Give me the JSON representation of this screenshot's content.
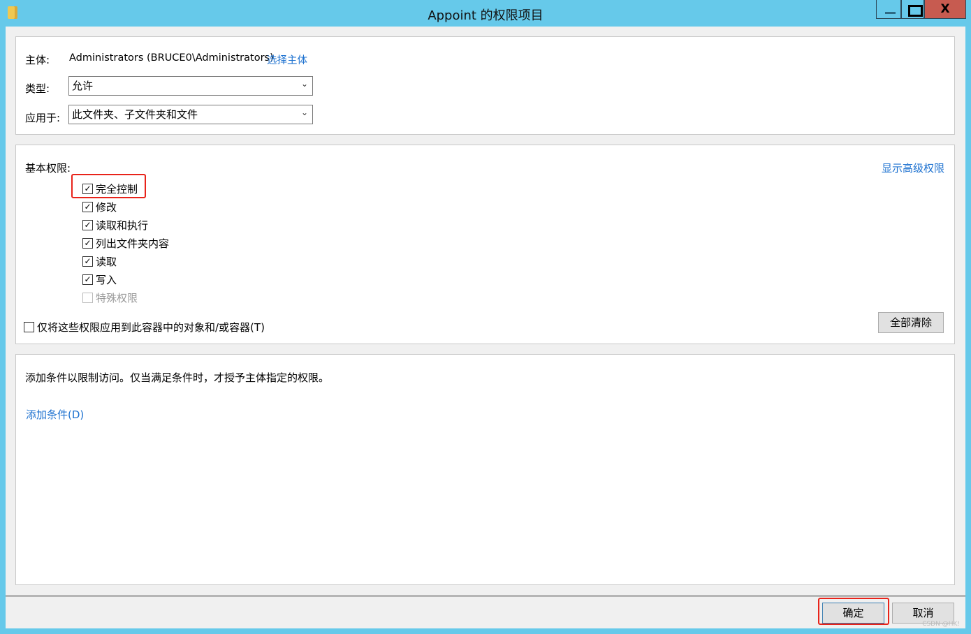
{
  "window": {
    "title": "Appoint 的权限项目",
    "icon": "folder-icon",
    "minimize": "minimize-icon",
    "maximize": "maximize-icon",
    "close_label": "X"
  },
  "principal": {
    "label": "主体:",
    "value": "Administrators (BRUCE0\\Administrators)",
    "select_link": "选择主体"
  },
  "type": {
    "label": "类型:",
    "value": "允许"
  },
  "applies_to": {
    "label": "应用于:",
    "value": "此文件夹、子文件夹和文件"
  },
  "permissions": {
    "title": "基本权限:",
    "advanced_link": "显示高级权限",
    "items": [
      {
        "label": "完全控制",
        "checked": true,
        "enabled": true
      },
      {
        "label": "修改",
        "checked": true,
        "enabled": true
      },
      {
        "label": "读取和执行",
        "checked": true,
        "enabled": true
      },
      {
        "label": "列出文件夹内容",
        "checked": true,
        "enabled": true
      },
      {
        "label": "读取",
        "checked": true,
        "enabled": true
      },
      {
        "label": "写入",
        "checked": true,
        "enabled": true
      },
      {
        "label": "特殊权限",
        "checked": false,
        "enabled": false
      }
    ],
    "container_only": {
      "label": "仅将这些权限应用到此容器中的对象和/或容器(T)",
      "checked": false
    },
    "clear_all": "全部清除"
  },
  "conditions": {
    "description": "添加条件以限制访问。仅当满足条件时，才授予主体指定的权限。",
    "add_link": "添加条件(D)"
  },
  "footer": {
    "ok": "确定",
    "cancel": "取消",
    "watermark": "CSDN @HK!"
  },
  "colors": {
    "titlebar": "#66c9ea",
    "close": "#c75b50",
    "link": "#1e72d0",
    "highlight": "#e8231a"
  }
}
